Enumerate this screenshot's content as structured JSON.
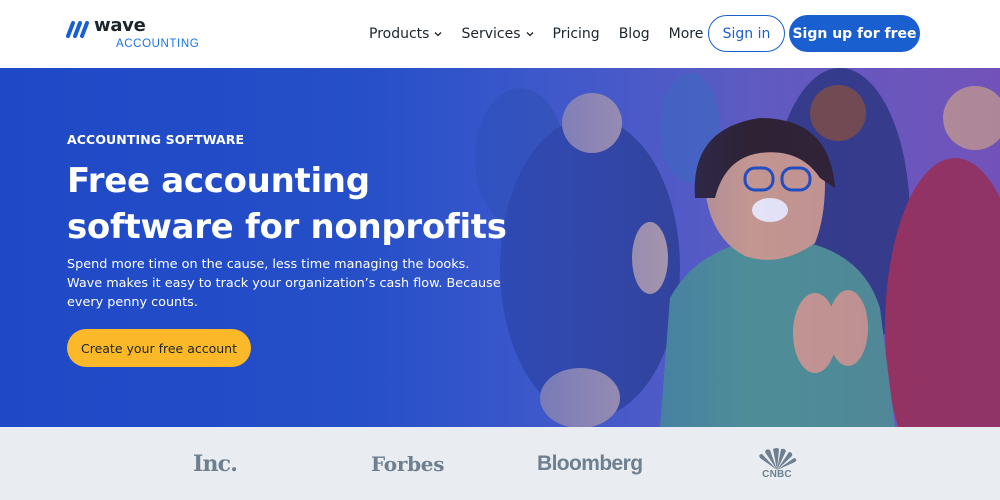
{
  "nav": {
    "logo": {
      "name": "wave",
      "sub": "ACCOUNTING"
    },
    "items": [
      {
        "label": "Products",
        "dropdown": true
      },
      {
        "label": "Services",
        "dropdown": true
      },
      {
        "label": "Pricing",
        "dropdown": false
      },
      {
        "label": "Blog",
        "dropdown": false
      },
      {
        "label": "More",
        "dropdown": true
      }
    ],
    "signin_label": "Sign in",
    "signup_label": "Sign up for free"
  },
  "hero": {
    "eyebrow": "ACCOUNTING SOFTWARE",
    "headline": "Free accounting software for nonprofits",
    "subtext": "Spend more time on the cause, less time managing the books. Wave makes it easy to track your organization’s cash flow. Because every penny counts.",
    "cta_label": "Create your free account"
  },
  "press": {
    "logos": [
      "Inc.",
      "Forbes",
      "Bloomberg",
      "CNBC"
    ]
  },
  "colors": {
    "brand_blue": "#1a5fd0",
    "accent_blue": "#1a73e8",
    "cta_yellow": "#fbb829",
    "text_dark": "#1c252c",
    "press_bg": "#e9edf1",
    "press_logo": "#6e7f8f"
  },
  "icons": {
    "logo": "wave-logo-icon",
    "dropdown": "chevron-down-icon",
    "cnbc": "peacock-icon"
  }
}
